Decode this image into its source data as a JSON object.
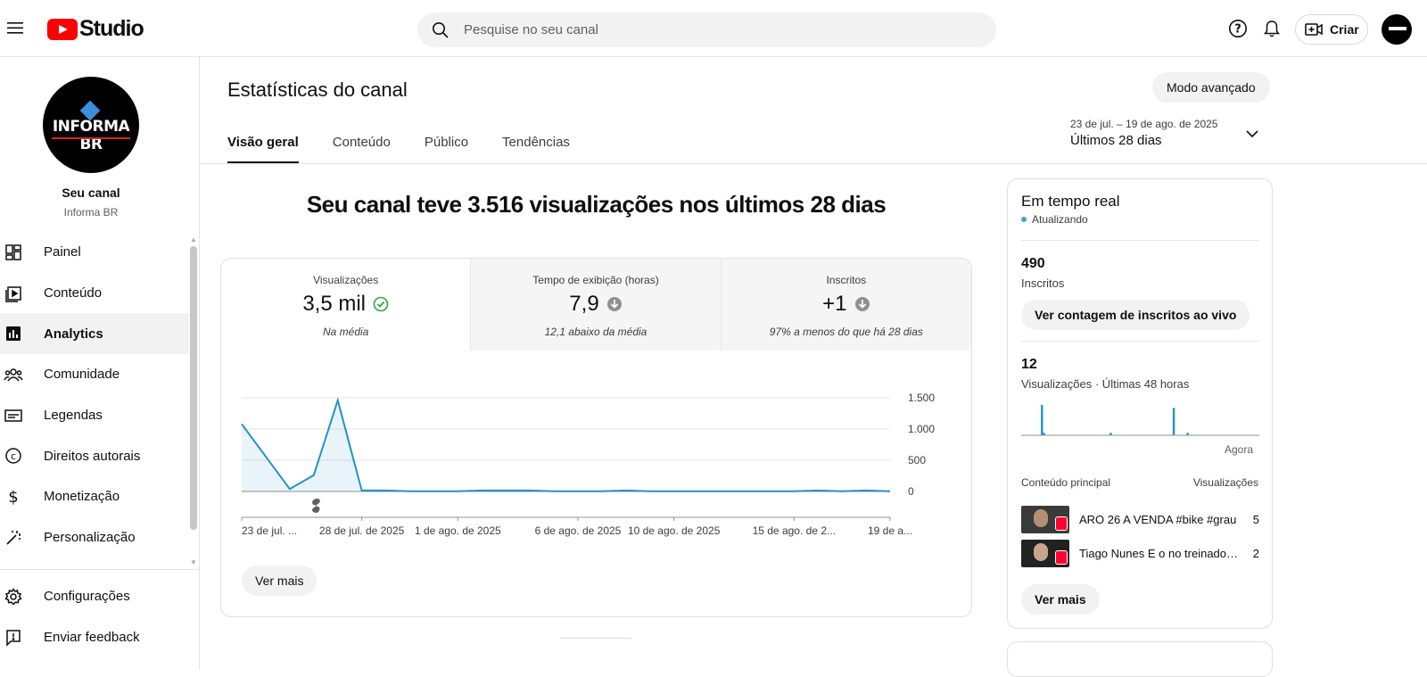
{
  "header": {
    "logo_text": "Studio",
    "search_placeholder": "Pesquise no seu canal",
    "create_label": "Criar"
  },
  "sidebar": {
    "channel_label": "Seu canal",
    "channel_name": "Informa BR",
    "avatar_text": "INFORMA BR",
    "items": [
      {
        "label": "Painel",
        "icon": "dashboard-icon"
      },
      {
        "label": "Conteúdo",
        "icon": "content-icon"
      },
      {
        "label": "Analytics",
        "icon": "analytics-icon",
        "active": true
      },
      {
        "label": "Comunidade",
        "icon": "community-icon"
      },
      {
        "label": "Legendas",
        "icon": "subtitles-icon"
      },
      {
        "label": "Direitos autorais",
        "icon": "copyright-icon"
      },
      {
        "label": "Monetização",
        "icon": "dollar-icon"
      },
      {
        "label": "Personalização",
        "icon": "magic-wand-icon"
      }
    ],
    "bottom_items": [
      {
        "label": "Configurações",
        "icon": "gear-icon"
      },
      {
        "label": "Enviar feedback",
        "icon": "feedback-icon"
      }
    ]
  },
  "main": {
    "title": "Estatísticas do canal",
    "advanced_label": "Modo avançado",
    "tabs": [
      "Visão geral",
      "Conteúdo",
      "Público",
      "Tendências"
    ],
    "date_range": "23 de jul. – 19 de ago. de 2025",
    "date_label": "Últimos 28 dias",
    "headline": "Seu canal teve 3.516 visualizações nos últimos 28 dias",
    "metrics": [
      {
        "label": "Visualizações",
        "value": "3,5 mil",
        "note": "Na média",
        "status": "check-icon"
      },
      {
        "label": "Tempo de exibição (horas)",
        "value": "7,9",
        "note": "12,1 abaixo da média",
        "status": "arrow-down-icon"
      },
      {
        "label": "Inscritos",
        "value": "+1",
        "note": "97% a menos do que há 28 dias",
        "status": "arrow-down-icon"
      }
    ],
    "see_more": "Ver mais"
  },
  "chart_data": {
    "type": "area",
    "x_ticks": [
      "23 de jul. ...",
      "28 de jul. de 2025",
      "1 de ago. de 2025",
      "6 de ago. de 2025",
      "10 de ago. de 2025",
      "15 de ago. de 2...",
      "19 de a..."
    ],
    "x_tick_days": [
      0,
      5,
      9,
      14,
      18,
      23,
      27
    ],
    "y_ticks": [
      "1.500",
      "1.000",
      "500",
      "0"
    ],
    "ylim": [
      0,
      1500
    ],
    "values": [
      1080,
      560,
      40,
      260,
      1460,
      15,
      15,
      5,
      5,
      5,
      15,
      15,
      15,
      5,
      5,
      5,
      15,
      5,
      5,
      5,
      5,
      5,
      5,
      5,
      15,
      5,
      15,
      5
    ],
    "color": "#2293c8",
    "shorts_marker_day": 3
  },
  "realtime": {
    "title": "Em tempo real",
    "status": "Atualizando",
    "subscribers_value": "490",
    "subscribers_label": "Inscritos",
    "live_count_button": "Ver contagem de inscritos ao vivo",
    "views_value": "12",
    "views_label": "Visualizações · Últimas 48 horas",
    "now_label": "Agora",
    "bars": [
      0,
      0,
      0,
      0,
      0,
      0,
      0,
      0,
      0,
      0,
      3,
      0.25,
      0,
      0,
      0,
      0,
      0,
      0,
      0,
      0,
      0,
      0,
      0,
      0,
      0,
      0,
      0,
      0,
      0,
      0,
      0,
      0,
      0,
      0,
      0,
      0,
      0,
      0,
      0,
      0,
      0,
      0,
      0,
      0,
      0,
      0.25,
      0,
      0,
      0,
      0,
      0,
      0,
      0,
      0,
      0,
      0,
      0,
      0,
      0,
      0,
      0,
      0,
      0,
      0,
      0,
      0,
      0,
      0,
      0,
      0,
      0,
      0,
      0,
      0,
      0,
      0,
      0,
      2.7,
      0,
      0,
      0,
      0,
      0,
      0,
      0.25,
      0,
      0,
      0,
      0,
      0,
      0,
      0,
      0,
      0,
      0,
      0,
      0,
      0,
      0,
      0,
      0,
      0,
      0,
      0,
      0,
      0,
      0,
      0,
      0,
      0,
      0,
      0,
      0,
      0,
      0,
      0,
      0,
      0,
      0,
      0,
      0
    ],
    "top_content_label": "Conteúdo principal",
    "top_views_label": "Visualizações",
    "top_content": [
      {
        "title": "ARO 26 A VENDA #bike #grau",
        "views": "5"
      },
      {
        "title": "Tiago Nunes E o no treinador do Santos",
        "views": "2"
      }
    ],
    "see_more": "Ver mais"
  }
}
